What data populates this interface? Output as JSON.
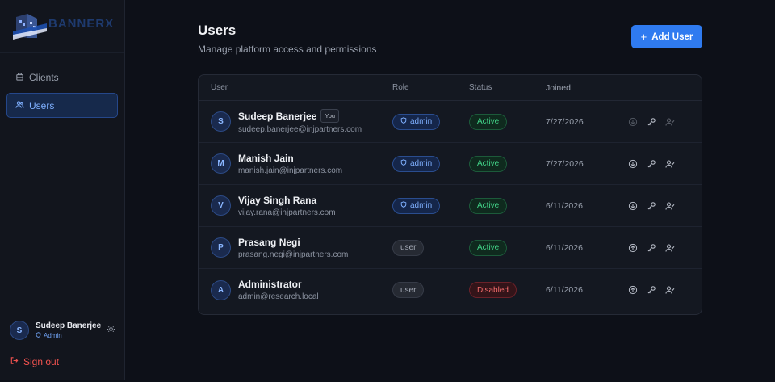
{
  "brand": {
    "name": "BANNERX"
  },
  "sidebar": {
    "items": [
      {
        "label": "Clients",
        "active": false
      },
      {
        "label": "Users",
        "active": true
      }
    ],
    "current_user": {
      "initial": "S",
      "name": "Sudeep Banerjee",
      "role": "Admin"
    },
    "signout_label": "Sign out"
  },
  "page": {
    "title": "Users",
    "subtitle": "Manage platform access and permissions",
    "add_button": "Add User"
  },
  "table": {
    "headers": {
      "user": "User",
      "role": "Role",
      "status": "Status",
      "joined": "Joined"
    },
    "rows": [
      {
        "initial": "S",
        "name": "Sudeep Banerjee",
        "you": "You",
        "email": "sudeep.banerjee@injpartners.com",
        "role": "admin",
        "status": "Active",
        "joined": "7/27/2026"
      },
      {
        "initial": "M",
        "name": "Manish Jain",
        "email": "manish.jain@injpartners.com",
        "role": "admin",
        "status": "Active",
        "joined": "7/27/2026"
      },
      {
        "initial": "V",
        "name": "Vijay Singh Rana",
        "email": "vijay.rana@injpartners.com",
        "role": "admin",
        "status": "Active",
        "joined": "6/11/2026"
      },
      {
        "initial": "P",
        "name": "Prasang Negi",
        "email": "prasang.negi@injpartners.com",
        "role": "user",
        "status": "Active",
        "joined": "6/11/2026"
      },
      {
        "initial": "A",
        "name": "Administrator",
        "email": "admin@research.local",
        "role": "user",
        "status": "Disabled",
        "joined": "6/11/2026"
      }
    ]
  },
  "colors": {
    "accent": "#2f7bf0",
    "active": "#43d68a",
    "disabled": "#f26b6b",
    "background": "#0d1018"
  },
  "icons": [
    "clients-icon",
    "users-icon",
    "shield-icon",
    "sun-icon",
    "sign-out-icon",
    "plus-icon",
    "arrow-circle-icon",
    "key-icon",
    "user-check-icon"
  ]
}
